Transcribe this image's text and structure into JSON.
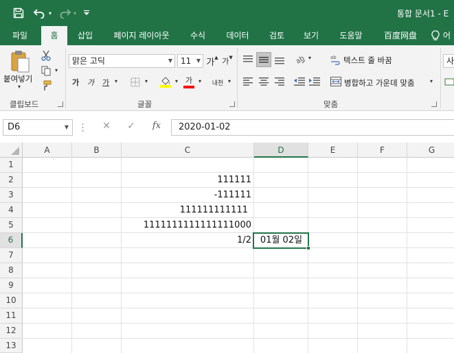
{
  "title_bar": {
    "title": "통합 문서1 - E",
    "icons": [
      "save-icon",
      "undo-icon",
      "redo-icon",
      "customize-quick-access-icon"
    ],
    "colors": {
      "background": "#217346",
      "text": "#ffffff"
    }
  },
  "tabs": [
    {
      "label": "파일",
      "active": false
    },
    {
      "label": "홈",
      "active": true
    },
    {
      "label": "삽입",
      "active": false
    },
    {
      "label": "페이지 레이아웃",
      "active": false
    },
    {
      "label": "수식",
      "active": false
    },
    {
      "label": "데이터",
      "active": false
    },
    {
      "label": "검토",
      "active": false
    },
    {
      "label": "보기",
      "active": false
    },
    {
      "label": "도움말",
      "active": false
    },
    {
      "label": "百度网盘",
      "active": false
    },
    {
      "label": "어",
      "active": false
    }
  ],
  "ribbon": {
    "clipboard": {
      "label": "클립보드",
      "paste_label": "붙여넣기",
      "icons": [
        "paste-icon",
        "cut-icon",
        "copy-icon",
        "format-painter-icon"
      ]
    },
    "font": {
      "label": "글꼴",
      "font_name": "맑은 고딕",
      "font_size": "11",
      "grow_label": "가",
      "shrink_label": "가",
      "bold_label": "가",
      "italic_label": "가",
      "underline_label": "가",
      "font_color_label": "가",
      "phonetic_label": "내천",
      "fill_color": "#ffff00",
      "font_color": "#ff0000"
    },
    "alignment": {
      "label": "맞춤",
      "wrap_text_label": "텍스트 줄 바꿈",
      "merge_center_label": "병합하고 가운데 맞춤"
    },
    "number": {
      "format_partial": "사"
    }
  },
  "formula_bar": {
    "name_box": "D6",
    "cancel_icon": "✕",
    "enter_icon": "✓",
    "fx_label": "fx",
    "formula": "2020-01-02"
  },
  "grid": {
    "columns": [
      "A",
      "B",
      "C",
      "D",
      "E",
      "F",
      "G"
    ],
    "rows": [
      "1",
      "2",
      "3",
      "4",
      "5",
      "6",
      "7",
      "8",
      "9",
      "10",
      "11",
      "12",
      "13"
    ],
    "selected_cell": "D6",
    "cells": {
      "C2": "111111",
      "C3": "-111111",
      "C4": "111111111111",
      "C5": "1111111111111111000",
      "C6": "1/2",
      "D6": "01월 02일"
    }
  }
}
